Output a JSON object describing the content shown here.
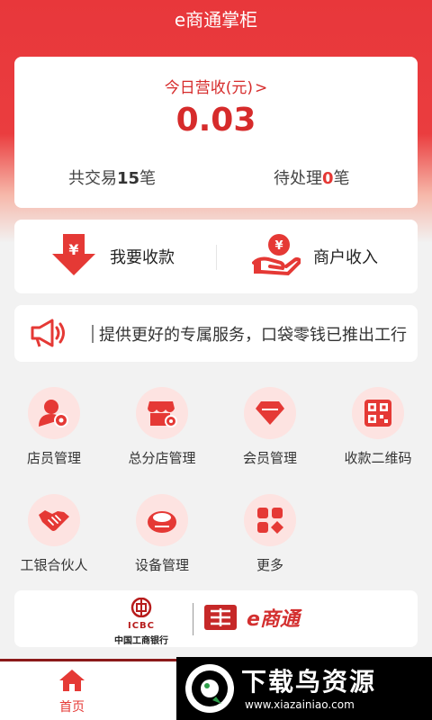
{
  "app": {
    "title": "e商通掌柜"
  },
  "revenue": {
    "label": "今日营收(元)",
    "value": "0.03",
    "transactions_prefix": "共交易",
    "transactions_count": "15",
    "transactions_suffix": "笔",
    "pending_prefix": "待处理",
    "pending_count": "0",
    "pending_suffix": "笔"
  },
  "actions": [
    {
      "label": "我要收款",
      "icon": "yen-down-arrow-icon"
    },
    {
      "label": "商户收入",
      "icon": "yen-hand-icon"
    }
  ],
  "notice": {
    "text": "提供更好的专属服务，口袋零钱已推出工行"
  },
  "grid": [
    {
      "label": "店员管理",
      "icon": "staff-icon"
    },
    {
      "label": "总分店管理",
      "icon": "store-icon"
    },
    {
      "label": "会员管理",
      "icon": "diamond-icon"
    },
    {
      "label": "收款二维码",
      "icon": "qrcode-icon"
    },
    {
      "label": "工银合伙人",
      "icon": "handshake-icon"
    },
    {
      "label": "设备管理",
      "icon": "device-icon"
    },
    {
      "label": "更多",
      "icon": "more-grid-icon"
    }
  ],
  "banner": {
    "icbc_en": "ICBC",
    "icbc_cn": "中国工商银行",
    "brand": "e商通"
  },
  "tabbar": {
    "home": "首页"
  },
  "watermark": {
    "title": "下载鸟资源",
    "url": "www.xiazainiao.com"
  },
  "colors": {
    "accent": "#e53935",
    "icon_bg": "#fde3e1",
    "background": "#f2f2f2"
  }
}
